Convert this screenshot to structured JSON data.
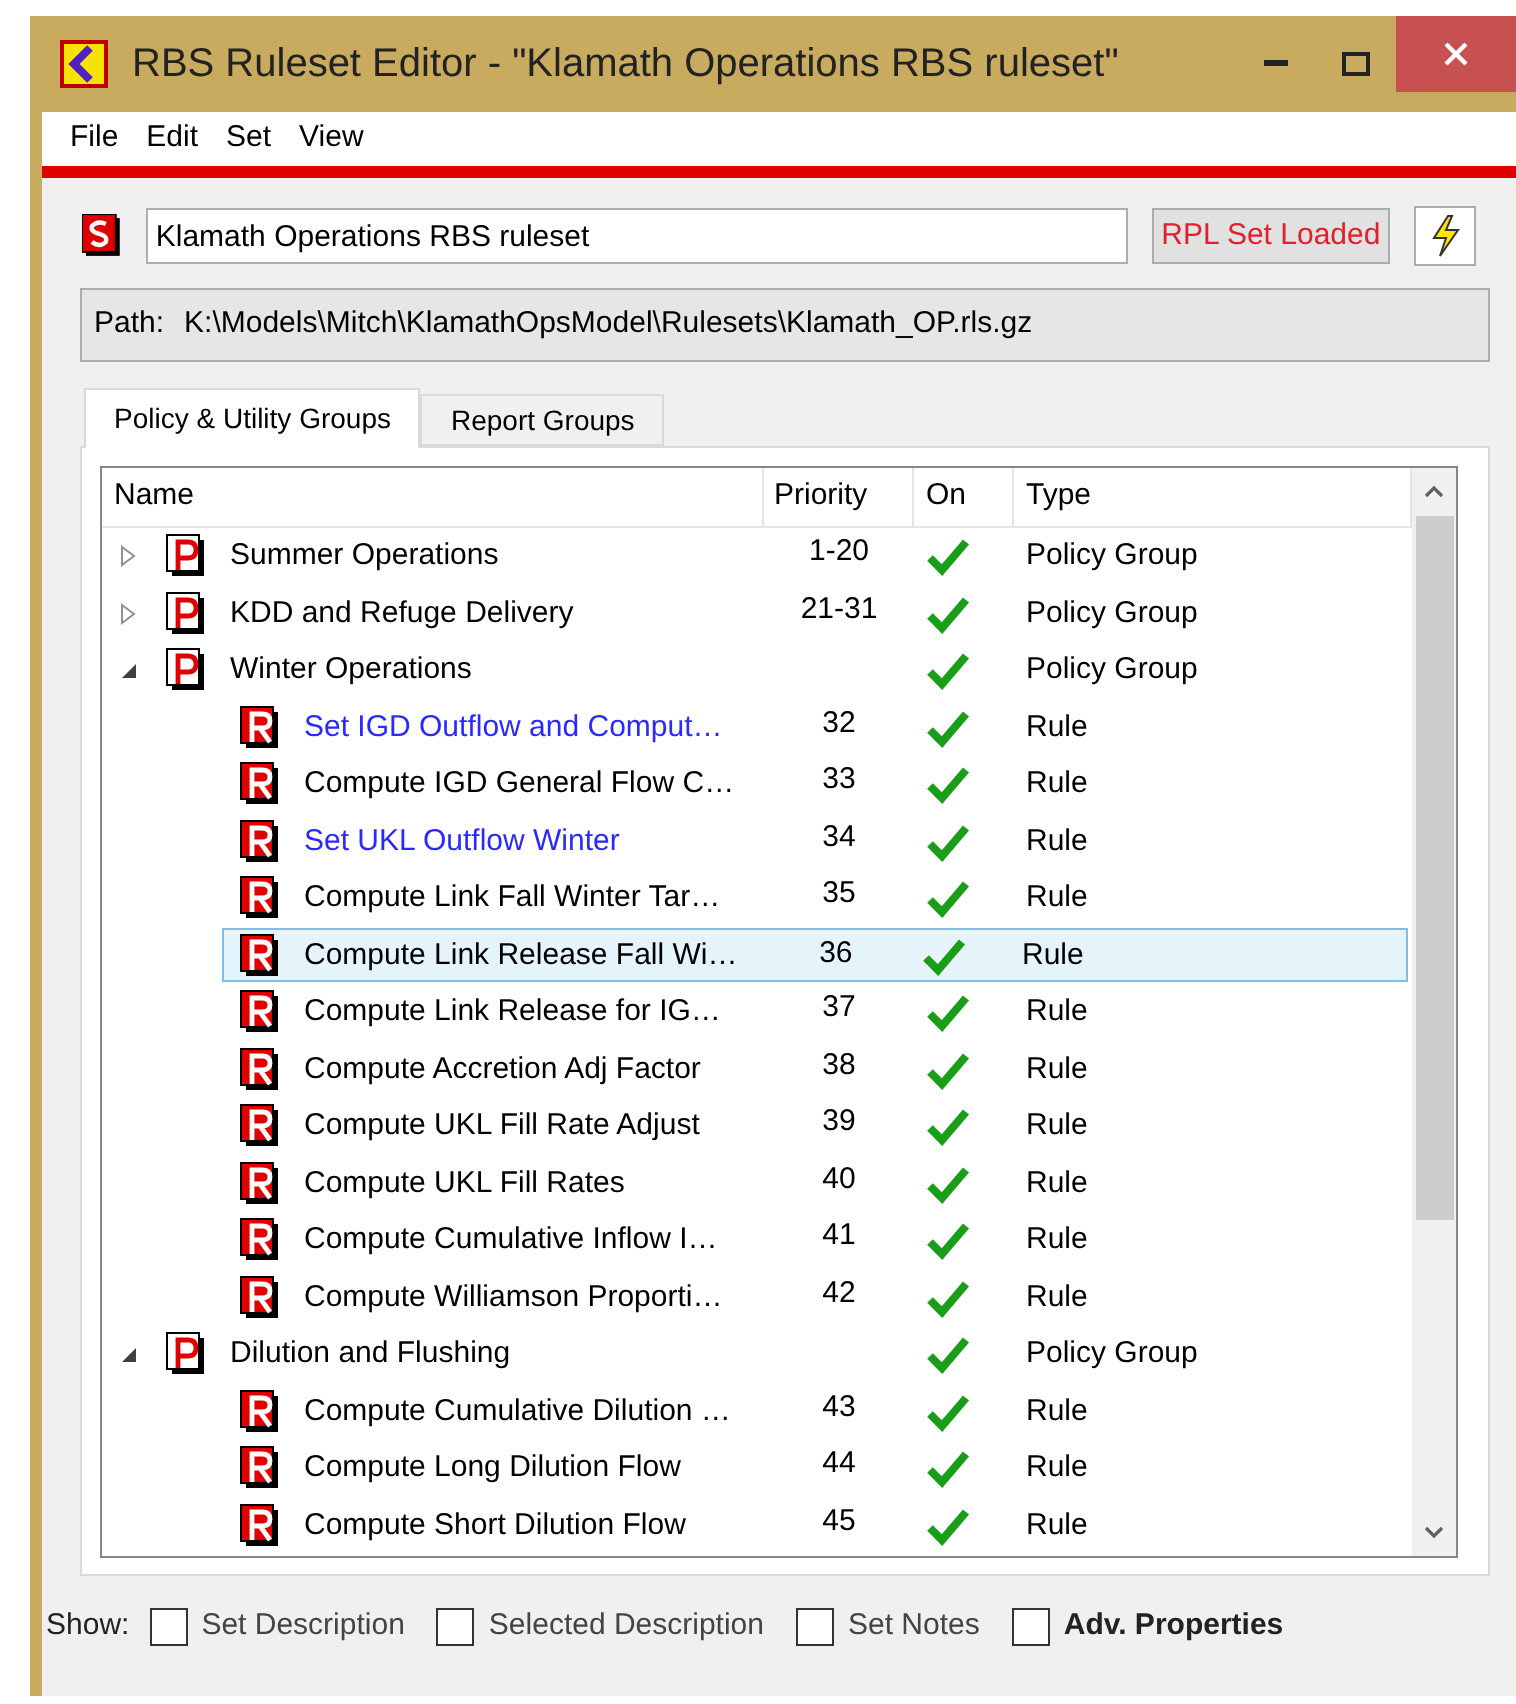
{
  "window": {
    "title": "RBS Ruleset Editor - \"Klamath Operations RBS ruleset\""
  },
  "menu": [
    "File",
    "Edit",
    "Set",
    "View"
  ],
  "ruleset": {
    "name": "Klamath Operations RBS ruleset",
    "status": "RPL Set Loaded"
  },
  "path": {
    "label": "Path:",
    "value": "K:\\Models\\Mitch\\KlamathOpsModel\\Rulesets\\Klamath_OP.rls.gz"
  },
  "tabs": [
    {
      "label": "Policy & Utility Groups",
      "selected": true
    },
    {
      "label": "Report Groups",
      "selected": false
    }
  ],
  "tree": {
    "columns": [
      "Name",
      "Priority",
      "On",
      "Type"
    ],
    "rows": [
      {
        "kind": "group",
        "name": "Summer Operations",
        "priority": "1-20",
        "on": true,
        "type": "Policy Group",
        "expanded": false,
        "selected": false,
        "color": "#000000"
      },
      {
        "kind": "group",
        "name": "KDD and Refuge Delivery",
        "priority": "21-31",
        "on": true,
        "type": "Policy Group",
        "expanded": false,
        "selected": false,
        "color": "#000000"
      },
      {
        "kind": "group",
        "name": "Winter Operations",
        "on": true,
        "type": "Policy Group",
        "expanded": true,
        "selected": false,
        "color": "#000000",
        "children": [
          {
            "kind": "rule",
            "name": "Set IGD Outflow and Comput…",
            "priority": "32",
            "on": true,
            "type": "Rule",
            "selected": false,
            "color": "#2a2aff"
          },
          {
            "kind": "rule",
            "name": "Compute IGD General Flow C…",
            "priority": "33",
            "on": true,
            "type": "Rule",
            "selected": false,
            "color": "#000000"
          },
          {
            "kind": "rule",
            "name": "Set UKL Outflow Winter",
            "priority": "34",
            "on": true,
            "type": "Rule",
            "selected": false,
            "color": "#2a2aff"
          },
          {
            "kind": "rule",
            "name": "Compute Link Fall Winter Tar…",
            "priority": "35",
            "on": true,
            "type": "Rule",
            "selected": false,
            "color": "#000000"
          },
          {
            "kind": "rule",
            "name": "Compute Link Release Fall Wi…",
            "priority": "36",
            "on": true,
            "type": "Rule",
            "selected": true,
            "color": "#000000"
          },
          {
            "kind": "rule",
            "name": "Compute Link Release for IG…",
            "priority": "37",
            "on": true,
            "type": "Rule",
            "selected": false,
            "color": "#000000"
          },
          {
            "kind": "rule",
            "name": "Compute Accretion Adj Factor",
            "priority": "38",
            "on": true,
            "type": "Rule",
            "selected": false,
            "color": "#000000"
          },
          {
            "kind": "rule",
            "name": "Compute UKL Fill Rate Adjust",
            "priority": "39",
            "on": true,
            "type": "Rule",
            "selected": false,
            "color": "#000000"
          },
          {
            "kind": "rule",
            "name": "Compute UKL Fill Rates",
            "priority": "40",
            "on": true,
            "type": "Rule",
            "selected": false,
            "color": "#000000"
          },
          {
            "kind": "rule",
            "name": "Compute Cumulative Inflow I…",
            "priority": "41",
            "on": true,
            "type": "Rule",
            "selected": false,
            "color": "#000000"
          },
          {
            "kind": "rule",
            "name": "Compute Williamson Proporti…",
            "priority": "42",
            "on": true,
            "type": "Rule",
            "selected": false,
            "color": "#000000"
          }
        ]
      },
      {
        "kind": "group",
        "name": "Dilution and Flushing",
        "on": true,
        "type": "Policy Group",
        "expanded": true,
        "selected": false,
        "color": "#000000",
        "children": [
          {
            "kind": "rule",
            "name": "Compute Cumulative Dilution …",
            "priority": "43",
            "on": true,
            "type": "Rule",
            "selected": false,
            "color": "#000000"
          },
          {
            "kind": "rule",
            "name": "Compute Long Dilution Flow",
            "priority": "44",
            "on": true,
            "type": "Rule",
            "selected": false,
            "color": "#000000"
          },
          {
            "kind": "rule",
            "name": "Compute Short Dilution Flow",
            "priority": "45",
            "on": true,
            "type": "Rule",
            "selected": false,
            "color": "#000000"
          }
        ]
      }
    ]
  },
  "show": {
    "label": "Show:",
    "options": [
      {
        "label": "Set Description",
        "checked": false,
        "bold": false
      },
      {
        "label": "Selected Description",
        "checked": false,
        "bold": false
      },
      {
        "label": "Set Notes",
        "checked": false,
        "bold": false
      },
      {
        "label": "Adv. Properties",
        "checked": false,
        "bold": true
      }
    ]
  }
}
